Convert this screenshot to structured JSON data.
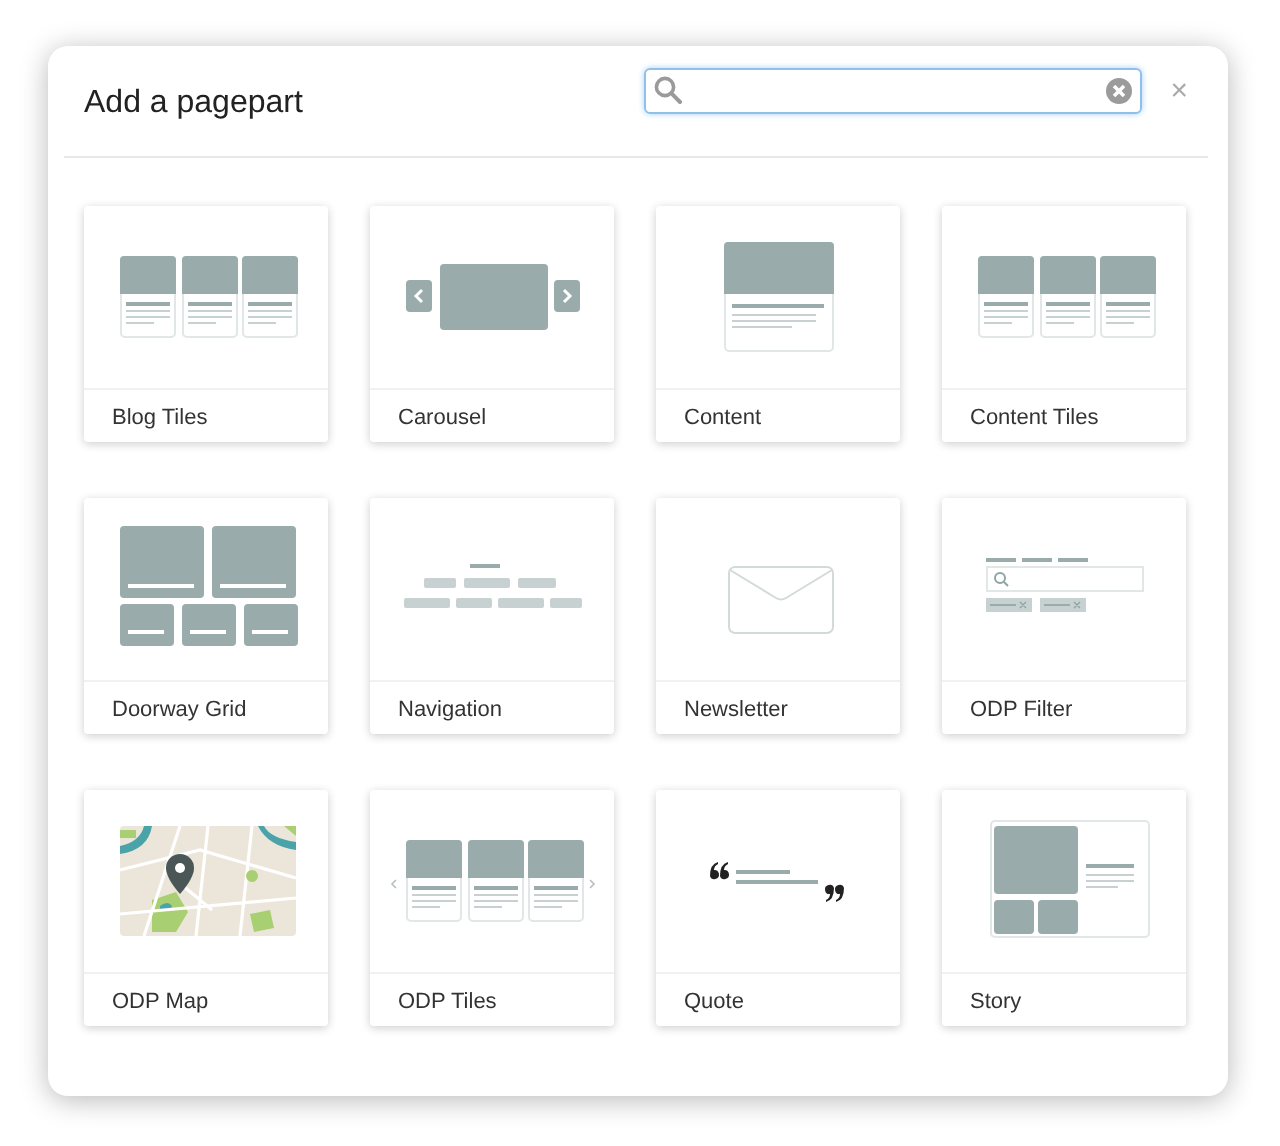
{
  "dialog": {
    "title": "Add a pagepart",
    "close": "×"
  },
  "pageparts": [
    {
      "label": "Blog Tiles",
      "kind": "tiles"
    },
    {
      "label": "Carousel",
      "kind": "carousel"
    },
    {
      "label": "Content",
      "kind": "content"
    },
    {
      "label": "Content Tiles",
      "kind": "tiles"
    },
    {
      "label": "Doorway Grid",
      "kind": "grid"
    },
    {
      "label": "Navigation",
      "kind": "navigation"
    },
    {
      "label": "Newsletter",
      "kind": "envelope"
    },
    {
      "label": "ODP Filter",
      "kind": "filter"
    },
    {
      "label": "ODP Map",
      "kind": "map"
    },
    {
      "label": "ODP Tiles",
      "kind": "slider-tiles"
    },
    {
      "label": "Quote",
      "kind": "quote"
    },
    {
      "label": "Story",
      "kind": "story"
    }
  ]
}
